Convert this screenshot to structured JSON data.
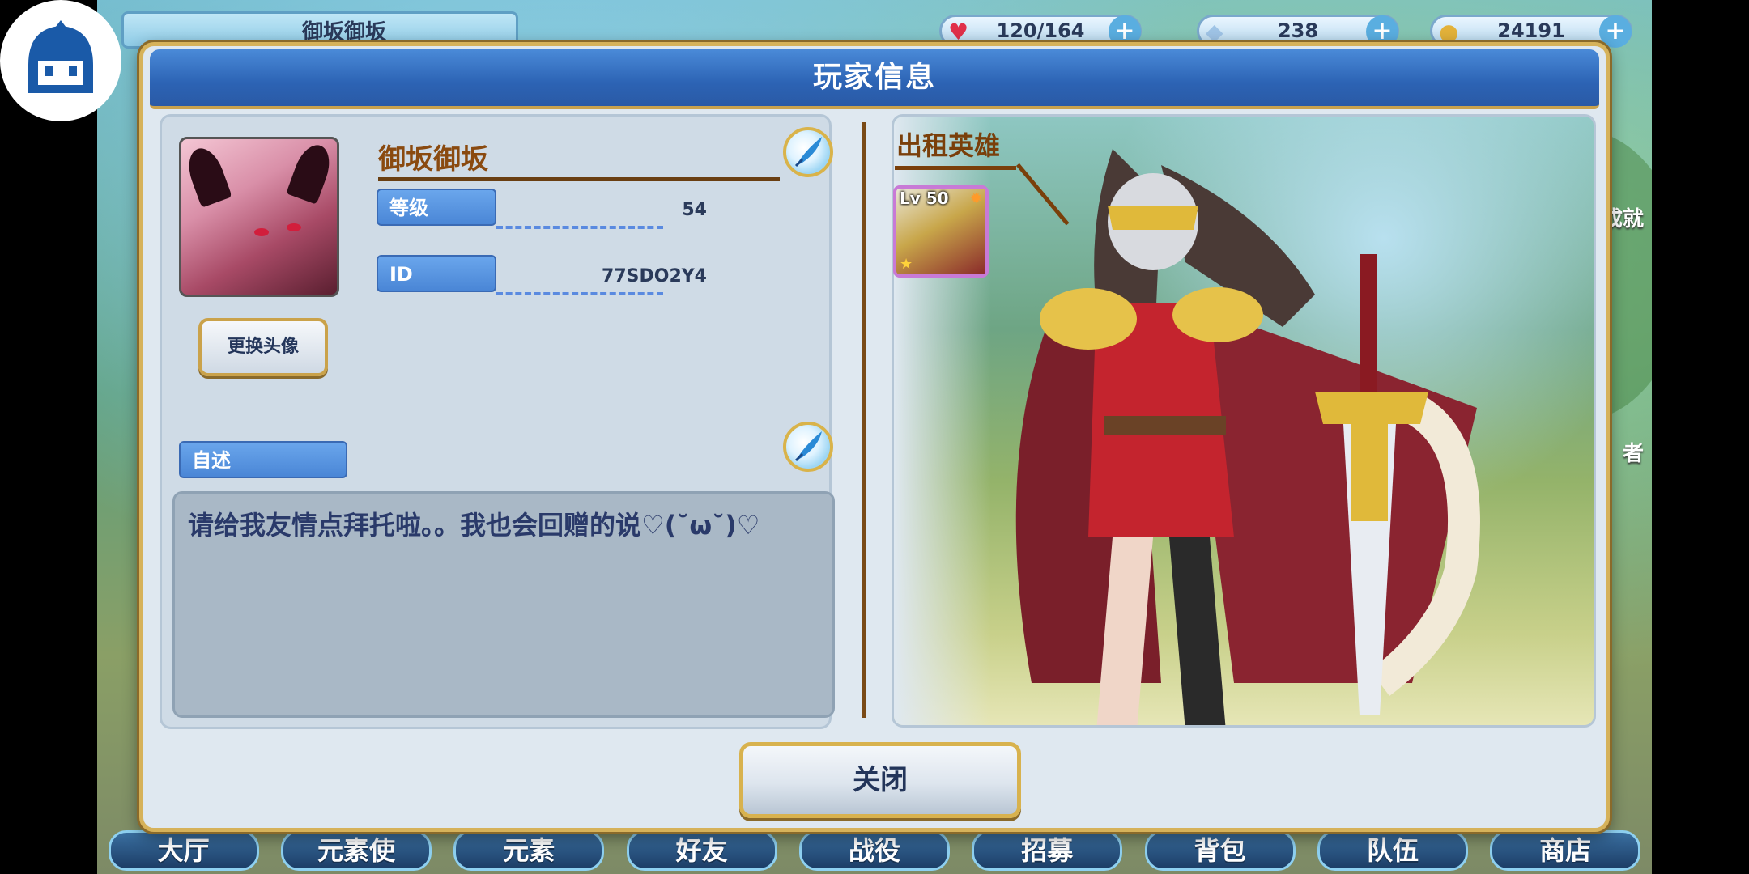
{
  "top_bar": {
    "player_name": "御坂御坂",
    "stamina": "120/164",
    "gems": "238",
    "gold": "24191"
  },
  "dialog": {
    "title": "玩家信息",
    "player_name": "御坂御坂",
    "level_label": "等级",
    "level_value": "54",
    "id_label": "ID",
    "id_value": "77SDO2Y4",
    "change_avatar_label": "更换头像",
    "bio_label": "自述",
    "bio_text": "请给我友情点拜托啦。。我也会回赠的说♡(˘ω˘)♡",
    "rental_hero_title": "出租英雄",
    "hero_level": "Lv 50",
    "close_label": "关闭"
  },
  "bottom_nav": [
    "大厅",
    "元素使",
    "元素",
    "好友",
    "战役",
    "招募",
    "背包",
    "队伍",
    "商店"
  ],
  "side_right": [
    "成就",
    "者"
  ],
  "colors": {
    "title_bar": "#2c63b4",
    "gold_border": "#d6b25a",
    "label_blue": "#4a86d6",
    "name_brown": "#8a4a10"
  }
}
